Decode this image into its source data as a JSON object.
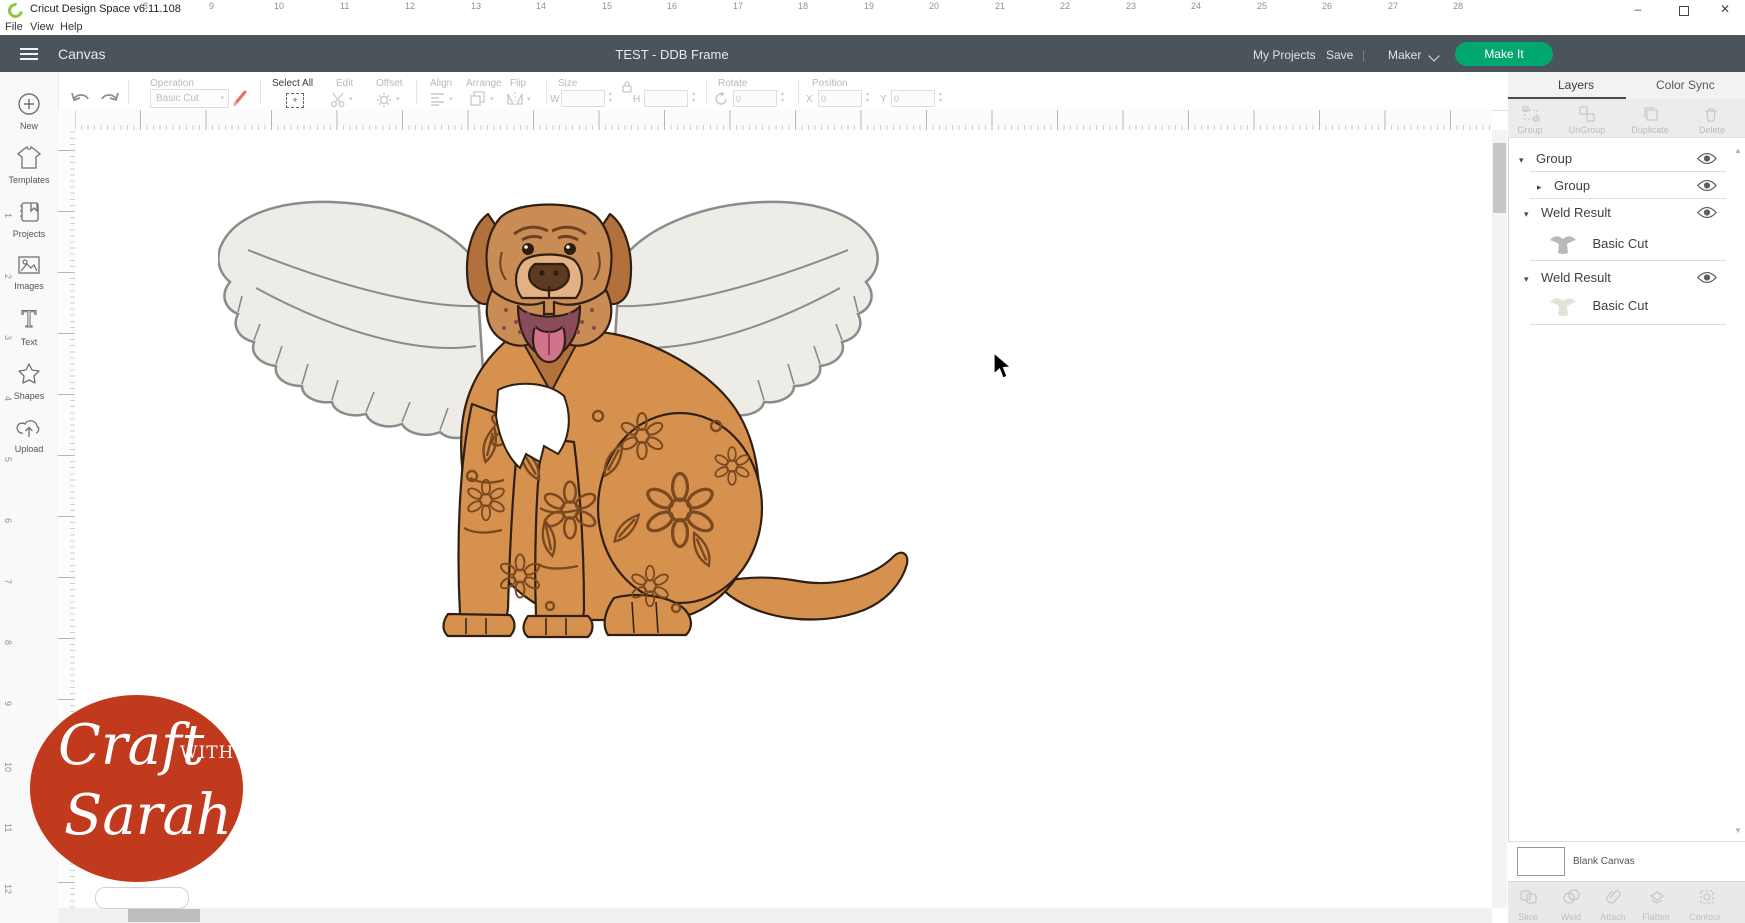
{
  "window": {
    "app_title": "Cricut Design Space  v6.11.108",
    "menus": [
      "File",
      "View",
      "Help"
    ]
  },
  "header": {
    "page_title": "Canvas",
    "document_title": "TEST - DDB Frame",
    "my_projects": "My Projects",
    "save": "Save",
    "divider": "|",
    "machine": "Maker",
    "make_it": "Make It"
  },
  "toolbar": {
    "operation_label": "Operation",
    "operation_value": "Basic Cut",
    "select_all": "Select All",
    "edit": "Edit",
    "offset": "Offset",
    "align": "Align",
    "arrange": "Arrange",
    "flip": "Flip",
    "size_label": "Size",
    "width_label": "W",
    "height_label": "H",
    "width_value": "",
    "height_value": "",
    "rotate_label": "Rotate",
    "rotate_value": "0",
    "position_label": "Position",
    "x_label": "X",
    "y_label": "Y",
    "x_value": "0",
    "y_value": "0"
  },
  "sidebar": {
    "items": [
      "New",
      "Templates",
      "Projects",
      "Images",
      "Text",
      "Shapes",
      "Upload"
    ]
  },
  "rulers": {
    "h": [
      "8",
      "9",
      "10",
      "11",
      "12",
      "13",
      "14",
      "15",
      "16",
      "17",
      "18",
      "19",
      "20",
      "21",
      "22",
      "23",
      "24",
      "25",
      "26",
      "27",
      "28"
    ],
    "v": [
      "1",
      "2",
      "3",
      "4",
      "5",
      "6",
      "7",
      "8",
      "9",
      "10",
      "11",
      "12"
    ]
  },
  "layers_panel": {
    "tab_layers": "Layers",
    "tab_color_sync": "Color Sync",
    "action_group": "Group",
    "action_ungroup": "UnGroup",
    "action_duplicate": "Duplicate",
    "action_delete": "Delete",
    "rows": [
      {
        "label": "Group",
        "caret": "▾",
        "eye": "visible"
      },
      {
        "label": "Group",
        "caret": "▸",
        "eye": "visible"
      },
      {
        "label": "Weld Result",
        "caret": "▾",
        "eye": "visible"
      },
      {
        "label": "Basic Cut",
        "thumb": "winged-dog-dark"
      },
      {
        "label": "Weld Result",
        "caret": "▾",
        "eye": "visible"
      },
      {
        "label": "Basic Cut",
        "thumb": "winged-dog-light"
      }
    ],
    "blank_canvas": "Blank Canvas",
    "slice": "Slice",
    "weld": "Weld",
    "attach": "Attach",
    "flatten": "Flatten",
    "contour": "Contour"
  },
  "watermark": {
    "craft": "Craft",
    "with": "with",
    "sarah": "Sarah"
  },
  "icons": {
    "minimize": "–",
    "close": "✕",
    "plus": "+",
    "caret_down": "▾",
    "stepper_up": "▴",
    "stepper_down": "▾",
    "scroll_up": "▲",
    "scroll_down": "▼"
  },
  "colors": {
    "header_bg": "#4a545a",
    "make_it_green": "#00a76f",
    "cricut_green": "#8dc63f",
    "watermark_red": "#c13a1d",
    "dog_orange": "#d6914f",
    "mandala_brown": "#7a4920",
    "wing_white": "#edece6"
  }
}
